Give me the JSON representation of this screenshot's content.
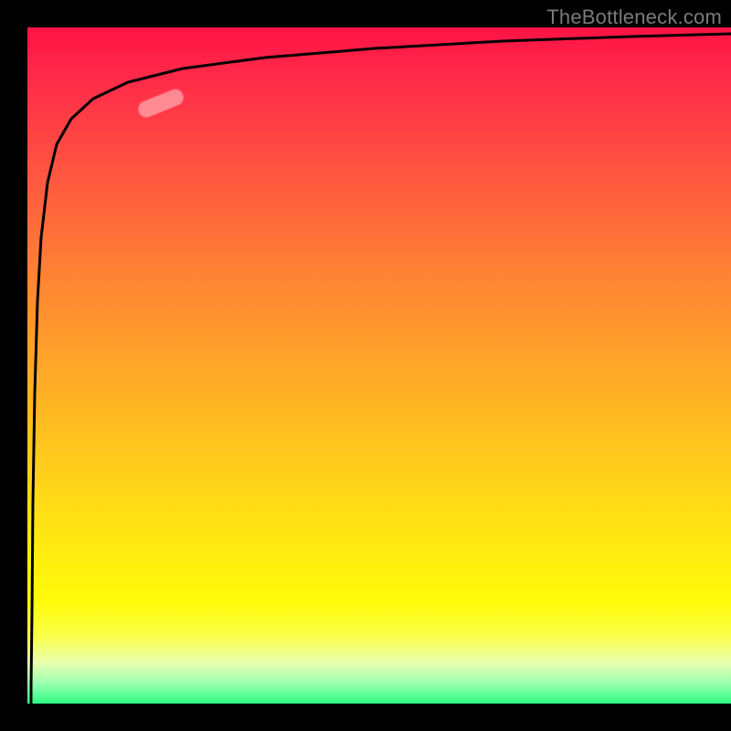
{
  "attribution": "TheBottleneck.com",
  "colors": {
    "background": "#000000",
    "gradient_top": "#ff1345",
    "gradient_mid": "#ffe812",
    "gradient_bottom": "#2cff82",
    "curve": "#000000",
    "highlight": "rgba(255,255,255,0.42)"
  },
  "chart_data": {
    "type": "line",
    "title": "",
    "xlabel": "",
    "ylabel": "",
    "xlim": [
      0,
      100
    ],
    "ylim": [
      0,
      100
    ],
    "x": [
      0,
      0.5,
      1,
      1.5,
      2,
      3,
      4,
      6,
      8,
      12,
      18,
      26,
      40,
      60,
      80,
      100
    ],
    "values": [
      0,
      20,
      46,
      64,
      75,
      83,
      87,
      90,
      92,
      94,
      95.5,
      96.6,
      97.6,
      98.4,
      98.9,
      99.2
    ],
    "series": [
      {
        "name": "curve",
        "x": [
          0,
          0.5,
          1,
          1.5,
          2,
          3,
          4,
          6,
          8,
          12,
          18,
          26,
          40,
          60,
          80,
          100
        ],
        "values": [
          0,
          20,
          46,
          64,
          75,
          83,
          87,
          90,
          92,
          94,
          95.5,
          96.6,
          97.6,
          98.4,
          98.9,
          99.2
        ]
      }
    ],
    "highlight_segment": {
      "x_start": 14,
      "x_end": 20,
      "y_start": 88,
      "y_end": 91
    }
  }
}
